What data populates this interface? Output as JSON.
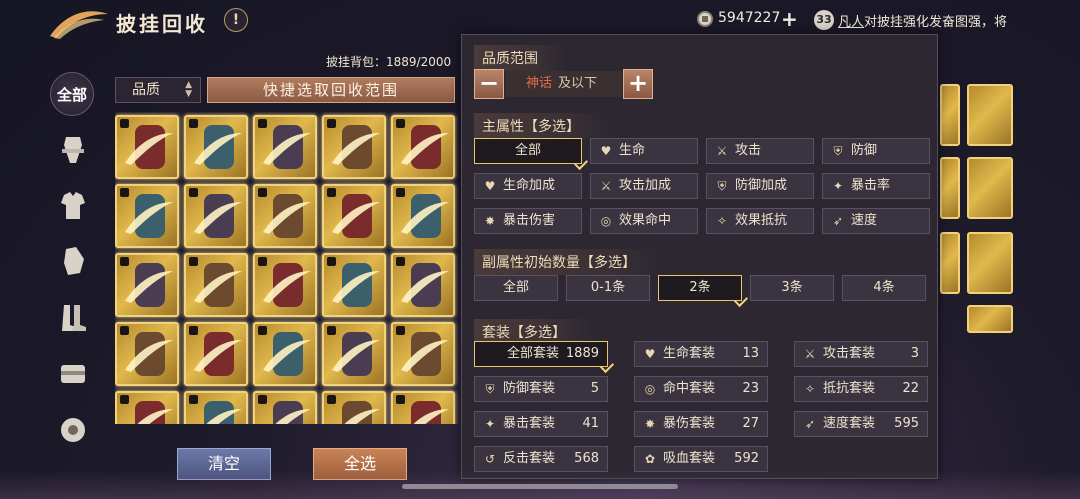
{
  "header": {
    "title": "披挂回收",
    "info_label": "!",
    "coins": "5947227",
    "coin_plus": "+",
    "level": "33",
    "chat_user": "凡人",
    "chat_text": "对披挂强化发奋图强，将"
  },
  "sidebar": {
    "items": [
      {
        "label": "全部",
        "icon": "all"
      },
      {
        "icon": "weapon-icon"
      },
      {
        "icon": "armor-icon"
      },
      {
        "icon": "gauntlet-icon"
      },
      {
        "icon": "boots-icon"
      },
      {
        "icon": "belt-icon"
      },
      {
        "icon": "accessory-icon"
      }
    ]
  },
  "bag": {
    "label": "披挂背包：1889/2000"
  },
  "filters": {
    "quality_label": "品质",
    "quick_select_label": "快捷选取回收范围"
  },
  "actions": {
    "clear_label": "清空",
    "select_all_label": "全选"
  },
  "popup": {
    "quality_section": {
      "title": "品质范围",
      "minus": "−",
      "plus": "+",
      "value": "神话",
      "suffix": "及以下"
    },
    "main_attr": {
      "title": "主属性【多选】",
      "options": [
        {
          "label": "全部",
          "icon": "",
          "selected": true
        },
        {
          "label": "生命",
          "icon": "heart-icon",
          "selected": false
        },
        {
          "label": "攻击",
          "icon": "sword-icon",
          "selected": false
        },
        {
          "label": "防御",
          "icon": "shield-icon",
          "selected": false
        },
        {
          "label": "生命加成",
          "icon": "heart-plus-icon",
          "selected": false
        },
        {
          "label": "攻击加成",
          "icon": "sword-plus-icon",
          "selected": false
        },
        {
          "label": "防御加成",
          "icon": "shield-plus-icon",
          "selected": false
        },
        {
          "label": "暴击率",
          "icon": "crit-icon",
          "selected": false
        },
        {
          "label": "暴击伤害",
          "icon": "crit-damage-icon",
          "selected": false
        },
        {
          "label": "效果命中",
          "icon": "hit-icon",
          "selected": false
        },
        {
          "label": "效果抵抗",
          "icon": "resist-icon",
          "selected": false
        },
        {
          "label": "速度",
          "icon": "speed-icon",
          "selected": false
        }
      ]
    },
    "sub_attr": {
      "title": "副属性初始数量【多选】",
      "options": [
        {
          "label": "全部",
          "selected": false
        },
        {
          "label": "0-1条",
          "selected": false
        },
        {
          "label": "2条",
          "selected": true
        },
        {
          "label": "3条",
          "selected": false
        },
        {
          "label": "4条",
          "selected": false
        }
      ]
    },
    "set": {
      "title": "套装【多选】",
      "options": [
        {
          "label": "全部套装",
          "count": "1889",
          "icon": "",
          "selected": true
        },
        {
          "label": "生命套装",
          "count": "13",
          "icon": "heart-icon",
          "selected": false
        },
        {
          "label": "攻击套装",
          "count": "3",
          "icon": "sword-icon",
          "selected": false
        },
        {
          "label": "防御套装",
          "count": "5",
          "icon": "shield-icon",
          "selected": false
        },
        {
          "label": "命中套装",
          "count": "23",
          "icon": "hit-icon",
          "selected": false
        },
        {
          "label": "抵抗套装",
          "count": "22",
          "icon": "resist-icon",
          "selected": false
        },
        {
          "label": "暴击套装",
          "count": "41",
          "icon": "crit-icon",
          "selected": false
        },
        {
          "label": "暴伤套装",
          "count": "27",
          "icon": "crit-damage-icon",
          "selected": false
        },
        {
          "label": "速度套装",
          "count": "595",
          "icon": "speed-icon",
          "selected": false
        },
        {
          "label": "反击套装",
          "count": "568",
          "icon": "counter-icon",
          "selected": false
        },
        {
          "label": "吸血套装",
          "count": "592",
          "icon": "lifesteal-icon",
          "selected": false
        }
      ]
    }
  },
  "colors": {
    "gold_border": "#f3d27c",
    "myth_red": "#e66b4d",
    "panel_bg": "#2c2731"
  }
}
